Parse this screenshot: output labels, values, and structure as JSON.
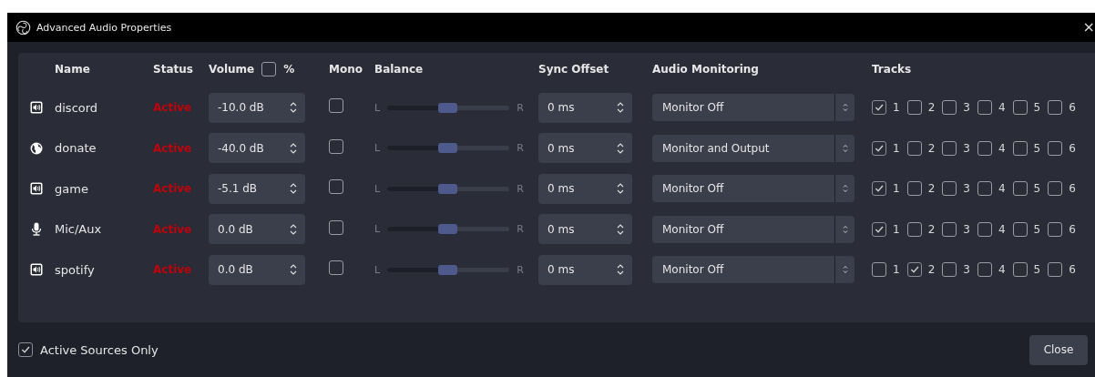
{
  "window": {
    "title": "Advanced Audio Properties",
    "close": "×"
  },
  "columns": {
    "name": "Name",
    "status": "Status",
    "volume": "Volume",
    "volume_percent": {
      "label": "%",
      "checked": false
    },
    "mono": "Mono",
    "balance": "Balance",
    "sync_offset": "Sync Offset",
    "audio_monitoring": "Audio Monitoring",
    "tracks": "Tracks"
  },
  "rows": [
    {
      "kind": "speaker",
      "name": "discord",
      "status": "Active",
      "volume": "-10.0 dB",
      "mono": false,
      "balance": {
        "left": "L",
        "right": "R",
        "level": 0.5
      },
      "sync_offset": "0 ms",
      "monitoring": "Monitor Off",
      "tracks": [
        {
          "label": "1",
          "checked": true
        },
        {
          "label": "2",
          "checked": false
        },
        {
          "label": "3",
          "checked": false
        },
        {
          "label": "4",
          "checked": false
        },
        {
          "label": "5",
          "checked": false
        },
        {
          "label": "6",
          "checked": false
        }
      ]
    },
    {
      "kind": "globe",
      "name": "donate",
      "status": "Active",
      "volume": "-40.0 dB",
      "mono": false,
      "balance": {
        "left": "L",
        "right": "R",
        "level": 0.5
      },
      "sync_offset": "0 ms",
      "monitoring": "Monitor and Output",
      "tracks": [
        {
          "label": "1",
          "checked": true
        },
        {
          "label": "2",
          "checked": false
        },
        {
          "label": "3",
          "checked": false
        },
        {
          "label": "4",
          "checked": false
        },
        {
          "label": "5",
          "checked": false
        },
        {
          "label": "6",
          "checked": false
        }
      ]
    },
    {
      "kind": "speaker",
      "name": "game",
      "status": "Active",
      "volume": "-5.1 dB",
      "mono": false,
      "balance": {
        "left": "L",
        "right": "R",
        "level": 0.5
      },
      "sync_offset": "0 ms",
      "monitoring": "Monitor Off",
      "tracks": [
        {
          "label": "1",
          "checked": true
        },
        {
          "label": "2",
          "checked": false
        },
        {
          "label": "3",
          "checked": false
        },
        {
          "label": "4",
          "checked": false
        },
        {
          "label": "5",
          "checked": false
        },
        {
          "label": "6",
          "checked": false
        }
      ]
    },
    {
      "kind": "mic",
      "name": "Mic/Aux",
      "status": "Active",
      "volume": "0.0 dB",
      "mono": false,
      "balance": {
        "left": "L",
        "right": "R",
        "level": 0.5
      },
      "sync_offset": "0 ms",
      "monitoring": "Monitor Off",
      "tracks": [
        {
          "label": "1",
          "checked": true
        },
        {
          "label": "2",
          "checked": false
        },
        {
          "label": "3",
          "checked": false
        },
        {
          "label": "4",
          "checked": false
        },
        {
          "label": "5",
          "checked": false
        },
        {
          "label": "6",
          "checked": false
        }
      ]
    },
    {
      "kind": "speaker",
      "name": "spotify",
      "status": "Active",
      "volume": "0.0 dB",
      "mono": false,
      "balance": {
        "left": "L",
        "right": "R",
        "level": 0.5
      },
      "sync_offset": "0 ms",
      "monitoring": "Monitor Off",
      "tracks": [
        {
          "label": "1",
          "checked": false
        },
        {
          "label": "2",
          "checked": true
        },
        {
          "label": "3",
          "checked": false
        },
        {
          "label": "4",
          "checked": false
        },
        {
          "label": "5",
          "checked": false
        },
        {
          "label": "6",
          "checked": false
        }
      ]
    }
  ],
  "footer": {
    "active_sources_only": {
      "label": "Active Sources Only",
      "checked": true
    },
    "close_button": "Close"
  }
}
